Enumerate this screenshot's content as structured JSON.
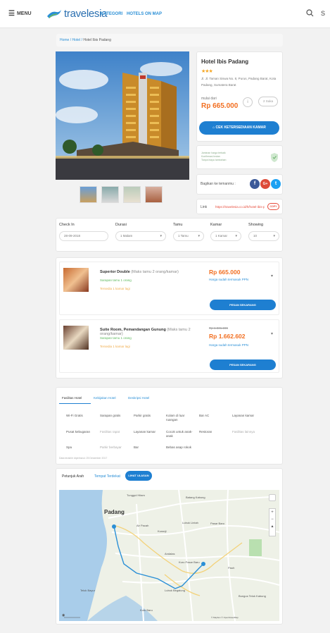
{
  "header": {
    "menu_label": "MENU",
    "logo_text": "travelesia",
    "nav": [
      "KATEGORI",
      "HOTELS ON MAP"
    ],
    "right_letter": "S"
  },
  "breadcrumb": [
    "Home",
    "Hotel",
    "Hotel Ibis Padang"
  ],
  "hotel": {
    "name": "Hotel Ibis Padang",
    "stars": "★★★",
    "address": "Jl. Jl. Taman Siswa No. 8, Purus, Padang Barat, Kota Padang, Sumatera Barat",
    "price_from_label": "mulai dari",
    "price": "Rp 665.000",
    "share_count": "2 Suka",
    "cta_label": "CEK KETERSEDIAAN KAMAR"
  },
  "notice": {
    "lines": [
      "Jaminan harga terbaik",
      "Konfirmasi instan",
      "Tanpa biaya tambahan"
    ]
  },
  "share": {
    "label": "Bagikan ke temanmu :",
    "facebook": "f",
    "google": "G+",
    "twitter": "t"
  },
  "link": {
    "label": "Link",
    "url": "https://travelesia.co.id/h/hotel-ibis-padang",
    "copy_label": "COPY"
  },
  "search": {
    "checkin_label": "Check In",
    "checkin_value": "28-09-2018",
    "duration_label": "Durasi",
    "duration_value": "1 Malam",
    "guest_label": "Tamu",
    "guest_value": "1 Tamu",
    "room_label": "Kamar",
    "room_value": "1 Kamar",
    "showing_label": "Showing",
    "showing_value": "10"
  },
  "rooms": [
    {
      "name": "Superior Double",
      "capacity": "(Maks tamu 2 orang/kamar)",
      "status": "Sarapan tamu 1 orang",
      "remaining": "Tersedia 1 kamar lagi",
      "strike_price": "",
      "price": "Rp 665.000",
      "tax": "Harga sudah termasuk PPN",
      "book_label": "PESAN SEKARANG"
    },
    {
      "name": "Suite Room, Pemandangan Gunung",
      "capacity": "(Maks tamu 2 orang/kamar)",
      "status": "Sarapan tamu 1 orang",
      "remaining": "Tersedia 1 kamar lagi",
      "strike_price": "Rp 1.831.236",
      "price": "Rp 1.662.602",
      "tax": "Harga sudah termasuk PPN",
      "book_label": "PESAN SEKARANG"
    }
  ],
  "facilities": {
    "tabs": [
      "Fasilitas Hotel",
      "Kebijakan Hotel",
      "Deskripsi Hotel"
    ],
    "items": [
      "Wi-Fi Gratis",
      "Sarapan gratis",
      "Parkir gratis",
      "Kolam di luar ruangan",
      "Bar AC",
      "Layanan kamar",
      "Pusat kebugaran",
      "Fasilitas rapat",
      "Layanan kamar",
      "Cocok untuk anak-anak",
      "Restoran",
      "Fasilitas lainnya",
      "Spa",
      "Parkir berbayar",
      "Bar",
      "Bebas asap rokok"
    ],
    "updated": "Data terakhir diperbarui: 25 Desember 2017"
  },
  "map": {
    "tabs": [
      "Petunjuk Arah",
      "Tempat Terdekat",
      "LIHAT ULASAN"
    ],
    "labels": {
      "padang": "Padang",
      "tunggul_hitam": "Tunggul Hitam",
      "batang_kabung": "Batang Kabung",
      "air_pacah": "Air Pacah",
      "kuranji": "Kuranji",
      "lubuk_lintah": "Lubuk Lintah",
      "pasar_baru": "Pasar Baru",
      "andalas": "Andalas",
      "kuru_pasar": "Kuru Pasar Baru",
      "pauh": "Pauh",
      "bungus": "Bungus Teluk Kabung",
      "teluk_bayur": "Teluk Bayur",
      "lubuk_begalung": "Lubuk Begalung",
      "koto_baru": "Koto Baru"
    },
    "attribution": "© Mapbox © OpenStreetMap"
  },
  "colors": {
    "brand_blue": "#1e7fd1",
    "price_orange": "#f26f21",
    "link_blue": "#2a8fd6"
  }
}
